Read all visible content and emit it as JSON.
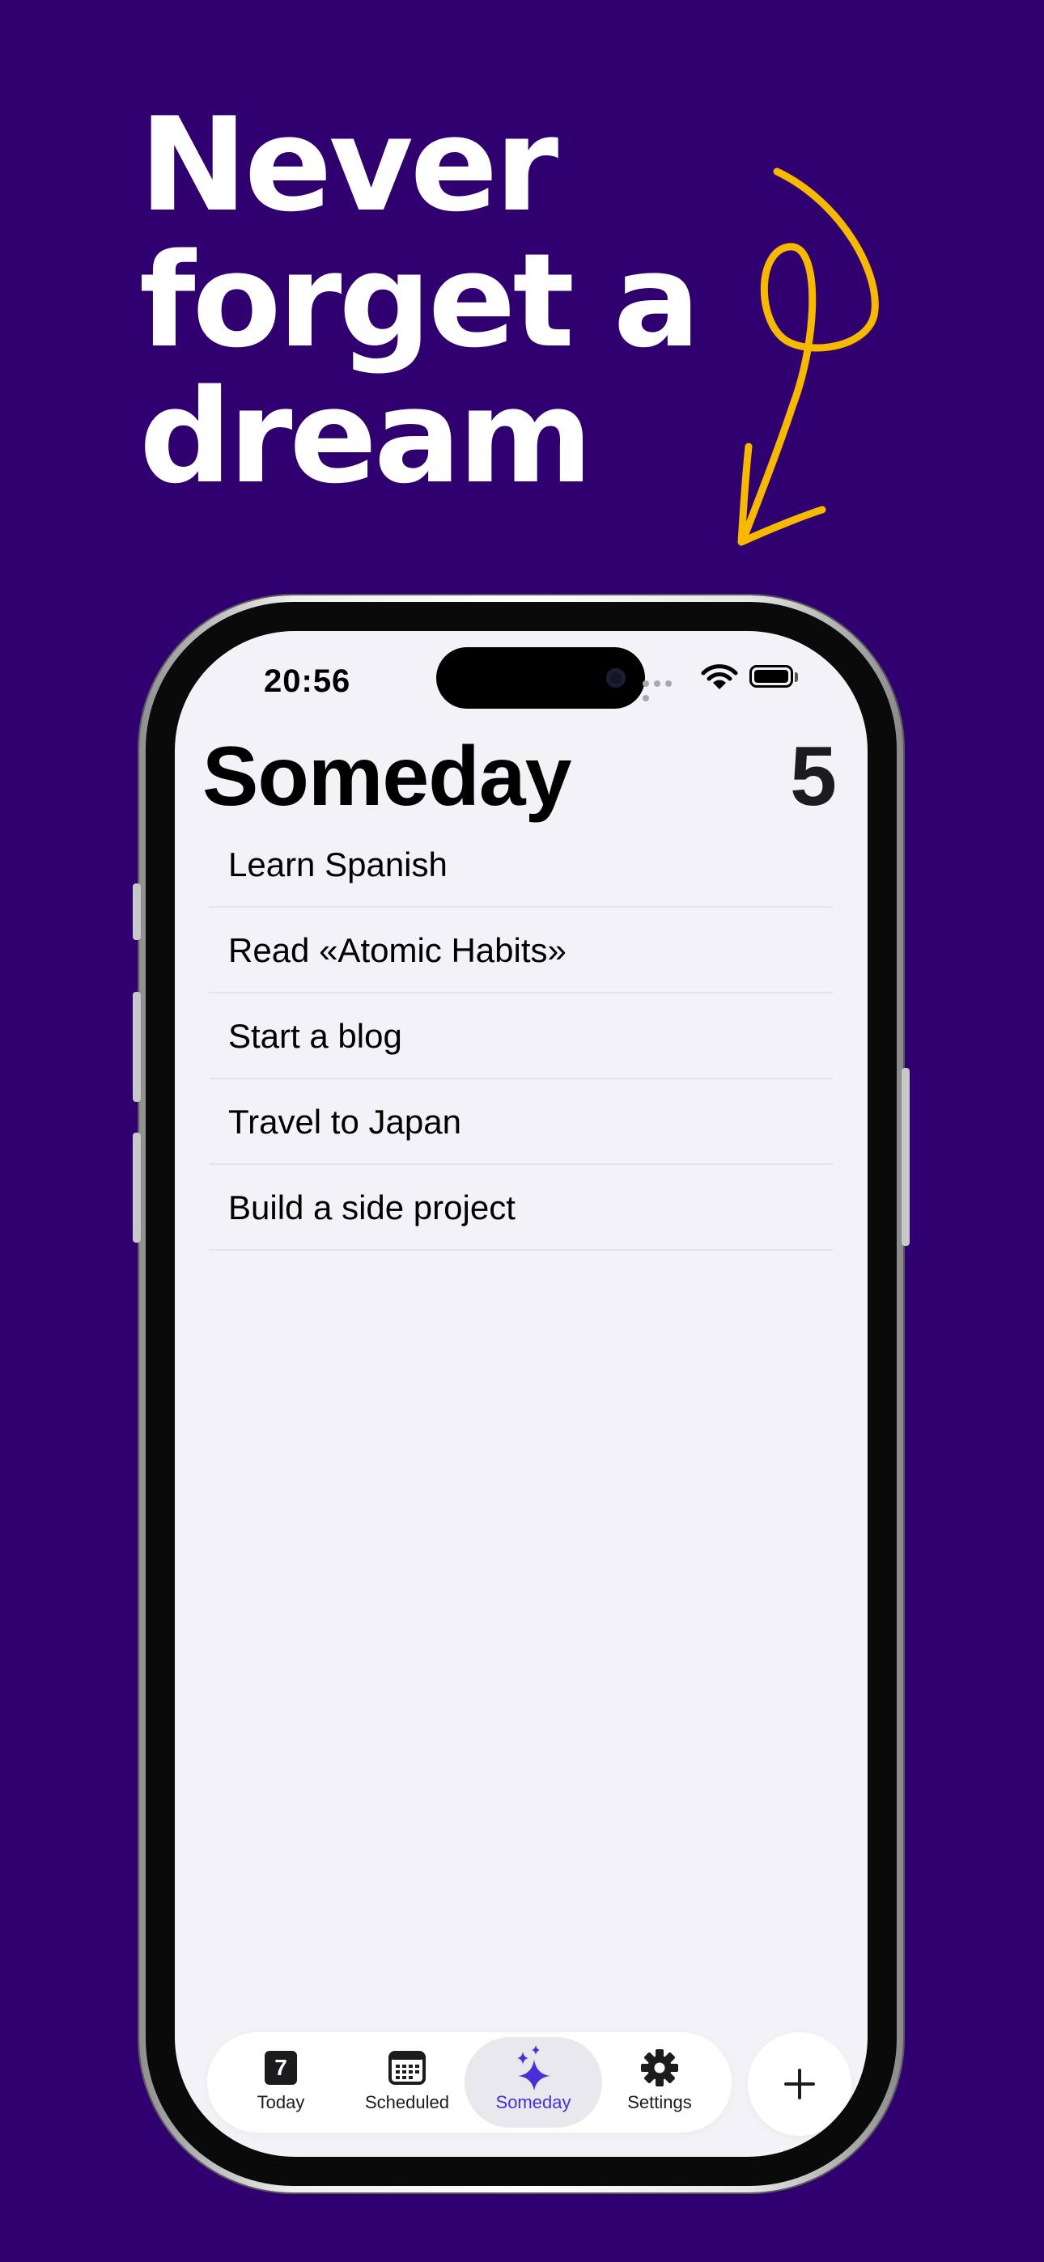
{
  "headline": {
    "lines": [
      "Never",
      "forget a",
      "dream"
    ]
  },
  "colors": {
    "background": "#300070",
    "arrow": "#f7b900",
    "accent": "#4a2fd6"
  },
  "status_bar": {
    "time": "20:56",
    "icons": [
      "cellular-icon",
      "wifi-icon",
      "battery-icon"
    ]
  },
  "screen": {
    "title": "Someday",
    "count": "5",
    "items": [
      "Learn Spanish",
      "Read «Atomic Habits»",
      "Start a blog",
      "Travel to Japan",
      "Build a side project"
    ]
  },
  "tab_bar": {
    "tabs": [
      {
        "label": "Today",
        "icon": "calendar-day-icon",
        "badge": "7"
      },
      {
        "label": "Scheduled",
        "icon": "calendar-grid-icon"
      },
      {
        "label": "Someday",
        "icon": "sparkles-icon",
        "active": true
      },
      {
        "label": "Settings",
        "icon": "gear-icon"
      }
    ],
    "add_button": {
      "icon": "plus-icon"
    }
  }
}
